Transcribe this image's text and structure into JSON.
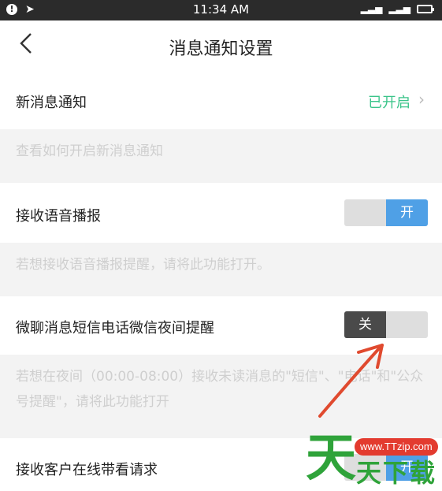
{
  "status_bar": {
    "time": "11:34 AM"
  },
  "nav": {
    "back_icon": "chevron-left-icon",
    "title": "消息通知设置"
  },
  "rows": {
    "new_msg": {
      "label": "新消息通知",
      "status": "已开启",
      "chevron": "›"
    },
    "hint_new": "查看如何开启新消息通知",
    "voice": {
      "label": "接收语音播报",
      "toggle_label": "开",
      "state": "on"
    },
    "hint_voice": "若想接收语音播报提醒，请将此功能打开。",
    "night": {
      "label": "微聊消息短信电话微信夜间提醒",
      "toggle_label": "关",
      "state": "off"
    },
    "hint_night": "若想在夜间（00:00-08:00）接收未读消息的\"短信\"、\"电话\"和\"公众号提醒\"，请将此功能打开",
    "online": {
      "label": "接收客户在线带看请求",
      "toggle_label": "开",
      "state": "on"
    }
  },
  "watermark": {
    "url": "www.TTzip.com",
    "big_char": "天",
    "text": "天下载"
  },
  "colors": {
    "accent_green": "#3bc48a",
    "toggle_on": "#4fa0e6",
    "toggle_off": "#4a4a4a",
    "arrow": "#e04a2f"
  }
}
